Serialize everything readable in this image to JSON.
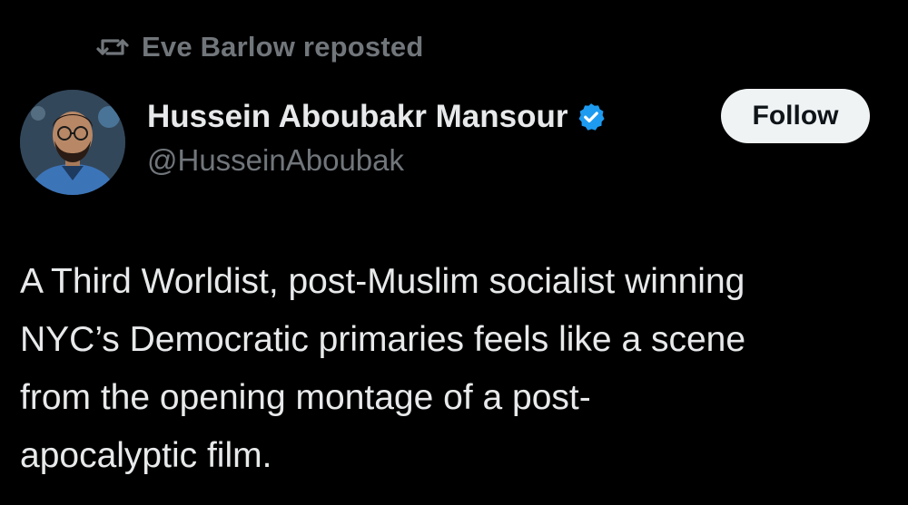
{
  "repost": {
    "icon": "repost-icon",
    "label": "Eve Barlow reposted"
  },
  "author": {
    "display_name": "Hussein Aboubakr Mansour",
    "handle": "@HusseinAboubak",
    "verified_icon": "verified-badge-icon",
    "verified_color": "#1d9bf0"
  },
  "follow_button": {
    "label": "Follow"
  },
  "post": {
    "lines": [
      "A Third Worldist, post-Muslim socialist winning",
      "NYC’s Democratic primaries feels like a scene",
      "from the opening montage of a post-",
      "apocalyptic film."
    ]
  },
  "colors": {
    "background": "#000000",
    "primary_text": "#e7e9ea",
    "secondary_text": "#71767b",
    "button_bg": "#eff3f4",
    "button_text": "#0f1419"
  }
}
